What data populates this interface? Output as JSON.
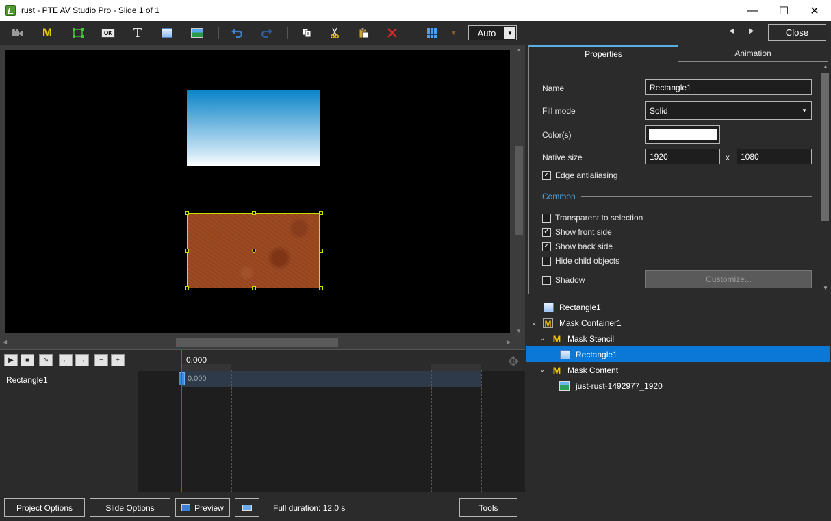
{
  "window": {
    "title": "rust - PTE AV Studio Pro - Slide 1 of 1",
    "minimize": "—",
    "maximize": "☐",
    "close": "✕"
  },
  "toolbar": {
    "icons": [
      "camera-icon",
      "mask-m-icon",
      "frame-icon",
      "button-ok-icon",
      "text-T-icon",
      "rectangle-icon",
      "image-icon",
      "undo-icon",
      "redo-icon",
      "copy-icon",
      "cut-icon",
      "paste-icon",
      "delete-icon",
      "grid-icon",
      "grid-dropdown-icon"
    ],
    "text_tool": "T",
    "mask_tool": "M",
    "ok_tool": "OK",
    "zoom_value": "Auto",
    "close_label": "Close"
  },
  "canvas": {
    "objects": [
      "Rectangle1 (gradient)",
      "just-rust-1492977_1920"
    ]
  },
  "timeline": {
    "time_label": "0.000",
    "track_name": "Rectangle1",
    "track_time": "0.000"
  },
  "properties": {
    "tabs": [
      {
        "label": "Properties"
      },
      {
        "label": "Animation"
      }
    ],
    "name_label": "Name",
    "name_value": "Rectangle1",
    "fill_mode_label": "Fill mode",
    "fill_mode_value": "Solid",
    "colors_label": "Color(s)",
    "color_value": "#ffffff",
    "native_size_label": "Native size",
    "native_w": "1920",
    "native_x": "x",
    "native_h": "1080",
    "edge_antialiasing": {
      "label": "Edge antialiasing",
      "checked": true
    },
    "common_label": "Common",
    "transparent_to_selection": {
      "label": "Transparent to selection",
      "checked": false
    },
    "show_front_side": {
      "label": "Show front side",
      "checked": true
    },
    "show_back_side": {
      "label": "Show back side",
      "checked": true
    },
    "hide_child_objects": {
      "label": "Hide child objects",
      "checked": false
    },
    "shadow": {
      "label": "Shadow",
      "checked": false
    },
    "customize_label": "Customize..."
  },
  "tree": {
    "items": [
      {
        "label": "Rectangle1"
      },
      {
        "label": "Mask Container1"
      },
      {
        "label": "Mask Stencil"
      },
      {
        "label": "Rectangle1"
      },
      {
        "label": "Mask Content"
      },
      {
        "label": "just-rust-1492977_1920"
      }
    ]
  },
  "bottom": {
    "project_options": "Project Options",
    "slide_options": "Slide Options",
    "preview": "Preview",
    "full_duration": "Full duration: 12.0 s",
    "tools": "Tools"
  },
  "colors": {
    "selection": "#0b78d7",
    "accent": "#4aa3e0",
    "handle": "#c8e000",
    "playhead": "#d03030"
  }
}
